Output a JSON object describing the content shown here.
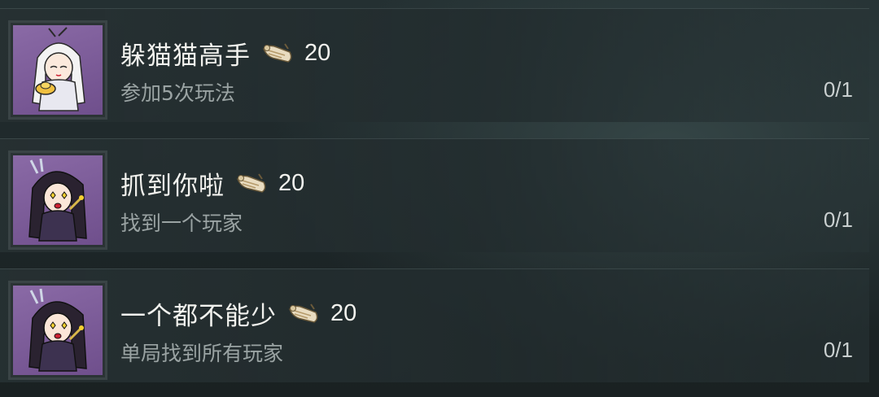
{
  "achievements": [
    {
      "title": "躲猫猫高手",
      "reward_value": "20",
      "reward_icon": "scroll-icon",
      "description": "参加5次玩法",
      "progress": "0/1",
      "avatar": "white-haired-character-avatar"
    },
    {
      "title": "抓到你啦",
      "reward_value": "20",
      "reward_icon": "scroll-icon",
      "description": "找到一个玩家",
      "progress": "0/1",
      "avatar": "dark-haired-character-avatar"
    },
    {
      "title": "一个都不能少",
      "reward_value": "20",
      "reward_icon": "scroll-icon",
      "description": "单局找到所有玩家",
      "progress": "0/1",
      "avatar": "dark-haired-character-avatar"
    }
  ],
  "colors": {
    "background": "#1c2526",
    "icon_bg": "#7a5a98",
    "title": "#f2f2ee",
    "description": "#9aa3a3"
  }
}
